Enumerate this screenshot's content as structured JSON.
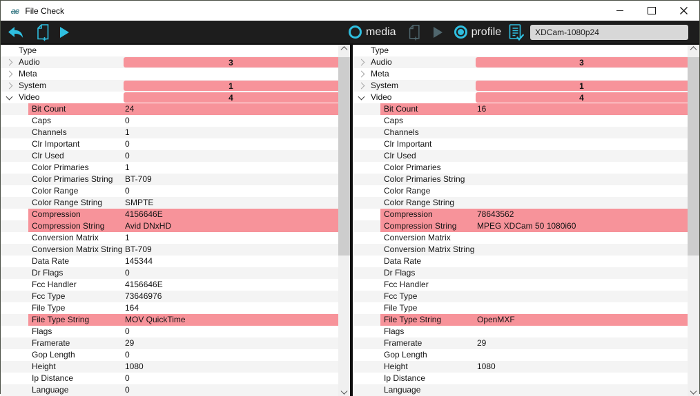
{
  "window": {
    "title": "File Check",
    "logo_text": "ac"
  },
  "colors": {
    "accent_teal": "#2fbfe0",
    "mismatch_pink": "#f7939a",
    "toolbar_bg": "#1d1d1d",
    "row_alt": "#f4f4f4"
  },
  "icons": [
    "app-logo",
    "back-arrow-icon",
    "new-file-icon",
    "run-icon",
    "media-radio",
    "new-file-icon-dim",
    "run-icon-dim",
    "profile-radio",
    "checklist-icon",
    "minimize-icon",
    "maximize-icon",
    "close-icon",
    "chevron-right-icon",
    "chevron-down-icon",
    "scroll-up-icon",
    "scroll-down-icon"
  ],
  "toolbar": {
    "media_label": "media",
    "profile_label": "profile",
    "profile_input": "XDCam-1080p24"
  },
  "tree": {
    "panels": [
      {
        "side": "left",
        "rows": [
          {
            "label": "Type",
            "type": "header"
          },
          {
            "label": "Audio",
            "type": "group",
            "chevron": "collapsed",
            "count": "3"
          },
          {
            "label": "Meta",
            "type": "group",
            "chevron": "collapsed"
          },
          {
            "label": "System",
            "type": "group",
            "chevron": "collapsed",
            "count": "1"
          },
          {
            "label": "Video",
            "type": "group",
            "chevron": "expanded",
            "count": "4"
          },
          {
            "label": "Bit Count",
            "type": "prop",
            "value": "24",
            "highlight": true
          },
          {
            "label": "Caps",
            "type": "prop",
            "value": "0"
          },
          {
            "label": "Channels",
            "type": "prop",
            "value": "1"
          },
          {
            "label": "Clr Important",
            "type": "prop",
            "value": "0"
          },
          {
            "label": "Clr Used",
            "type": "prop",
            "value": "0"
          },
          {
            "label": "Color Primaries",
            "type": "prop",
            "value": "1"
          },
          {
            "label": "Color Primaries String",
            "type": "prop",
            "value": "BT-709"
          },
          {
            "label": "Color Range",
            "type": "prop",
            "value": "0"
          },
          {
            "label": "Color Range String",
            "type": "prop",
            "value": "SMPTE"
          },
          {
            "label": "Compression",
            "type": "prop",
            "value": "4156646E",
            "highlight": true
          },
          {
            "label": "Compression String",
            "type": "prop",
            "value": "Avid DNxHD",
            "highlight": true
          },
          {
            "label": "Conversion Matrix",
            "type": "prop",
            "value": "1"
          },
          {
            "label": "Conversion Matrix String",
            "type": "prop",
            "value": "BT-709"
          },
          {
            "label": "Data Rate",
            "type": "prop",
            "value": "145344"
          },
          {
            "label": "Dr Flags",
            "type": "prop",
            "value": "0"
          },
          {
            "label": "Fcc Handler",
            "type": "prop",
            "value": "4156646E"
          },
          {
            "label": "Fcc Type",
            "type": "prop",
            "value": "73646976"
          },
          {
            "label": "File Type",
            "type": "prop",
            "value": "164"
          },
          {
            "label": "File Type String",
            "type": "prop",
            "value": "MOV QuickTime",
            "highlight": true
          },
          {
            "label": "Flags",
            "type": "prop",
            "value": "0"
          },
          {
            "label": "Framerate",
            "type": "prop",
            "value": "29"
          },
          {
            "label": "Gop Length",
            "type": "prop",
            "value": "0"
          },
          {
            "label": "Height",
            "type": "prop",
            "value": "1080"
          },
          {
            "label": "Ip Distance",
            "type": "prop",
            "value": "0"
          },
          {
            "label": "Language",
            "type": "prop",
            "value": "0"
          }
        ]
      },
      {
        "side": "right",
        "rows": [
          {
            "label": "Type",
            "type": "header"
          },
          {
            "label": "Audio",
            "type": "group",
            "chevron": "collapsed",
            "count": "3"
          },
          {
            "label": "Meta",
            "type": "group",
            "chevron": "collapsed"
          },
          {
            "label": "System",
            "type": "group",
            "chevron": "collapsed",
            "count": "1"
          },
          {
            "label": "Video",
            "type": "group",
            "chevron": "expanded",
            "count": "4"
          },
          {
            "label": "Bit Count",
            "type": "prop",
            "value": "16",
            "highlight": true
          },
          {
            "label": "Caps",
            "type": "prop",
            "value": ""
          },
          {
            "label": "Channels",
            "type": "prop",
            "value": ""
          },
          {
            "label": "Clr Important",
            "type": "prop",
            "value": ""
          },
          {
            "label": "Clr Used",
            "type": "prop",
            "value": ""
          },
          {
            "label": "Color Primaries",
            "type": "prop",
            "value": ""
          },
          {
            "label": "Color Primaries String",
            "type": "prop",
            "value": ""
          },
          {
            "label": "Color Range",
            "type": "prop",
            "value": ""
          },
          {
            "label": "Color Range String",
            "type": "prop",
            "value": ""
          },
          {
            "label": "Compression",
            "type": "prop",
            "value": "78643562",
            "highlight": true
          },
          {
            "label": "Compression String",
            "type": "prop",
            "value": "MPEG XDCam 50 1080i60",
            "highlight": true
          },
          {
            "label": "Conversion Matrix",
            "type": "prop",
            "value": ""
          },
          {
            "label": "Conversion Matrix String",
            "type": "prop",
            "value": ""
          },
          {
            "label": "Data Rate",
            "type": "prop",
            "value": ""
          },
          {
            "label": "Dr Flags",
            "type": "prop",
            "value": ""
          },
          {
            "label": "Fcc Handler",
            "type": "prop",
            "value": ""
          },
          {
            "label": "Fcc Type",
            "type": "prop",
            "value": ""
          },
          {
            "label": "File Type",
            "type": "prop",
            "value": ""
          },
          {
            "label": "File Type String",
            "type": "prop",
            "value": "OpenMXF",
            "highlight": true
          },
          {
            "label": "Flags",
            "type": "prop",
            "value": ""
          },
          {
            "label": "Framerate",
            "type": "prop",
            "value": "29"
          },
          {
            "label": "Gop Length",
            "type": "prop",
            "value": ""
          },
          {
            "label": "Height",
            "type": "prop",
            "value": "1080"
          },
          {
            "label": "Ip Distance",
            "type": "prop",
            "value": ""
          },
          {
            "label": "Language",
            "type": "prop",
            "value": ""
          }
        ]
      }
    ]
  }
}
